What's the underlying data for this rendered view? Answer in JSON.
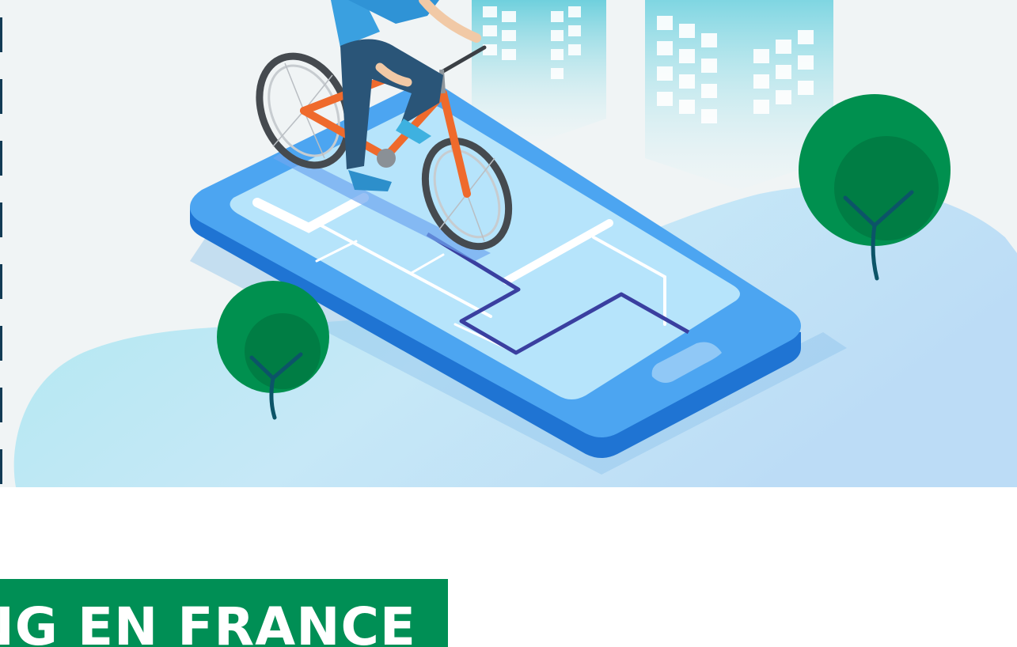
{
  "colors": {
    "background": "#f0f4f5",
    "banner_green": "#008f55",
    "tree_green": "#00904f",
    "phone_blue": "#2f8ae8",
    "route_navy": "#3a3fa0",
    "building_teal": "#6fcfe0"
  },
  "icons": {
    "illustration": "cyclist-on-smartphone-map-illustration",
    "trees": "tree-icon",
    "buildings": "building-icon",
    "bicycle": "bicycle-icon",
    "route": "route-path-icon"
  },
  "banner": {
    "title": "NG EN FRANCE"
  }
}
